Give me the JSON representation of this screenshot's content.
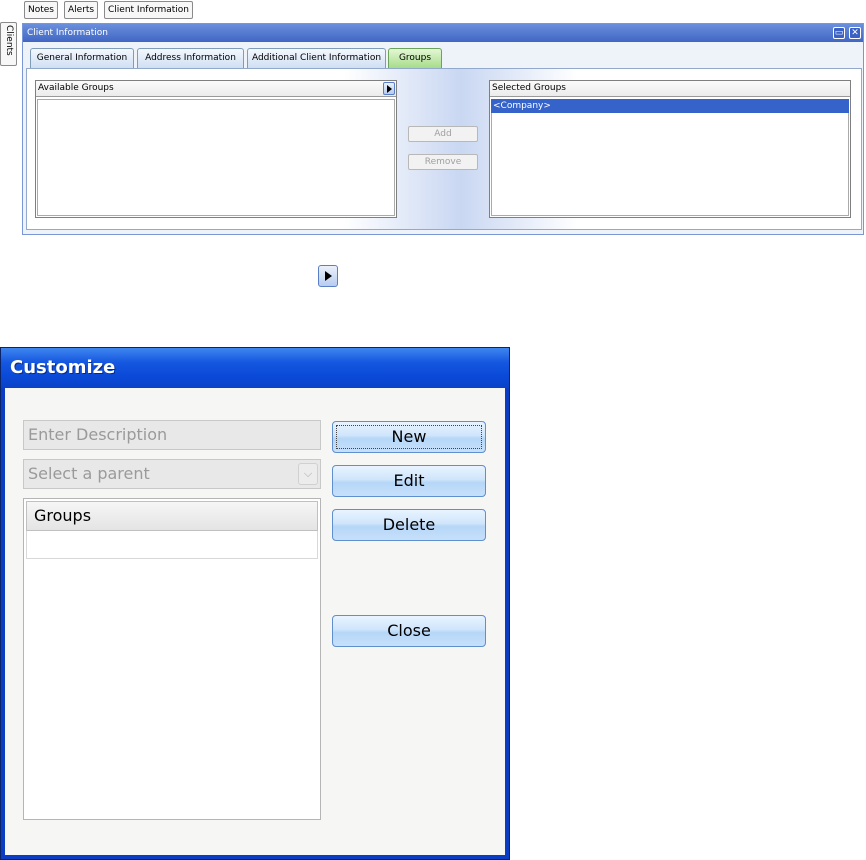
{
  "top_tabs": [
    "Notes",
    "Alerts",
    "Client Information"
  ],
  "side_tab": "Clients",
  "panel": {
    "title": "Client Information",
    "tabs": [
      "General Information",
      "Address Information",
      "Additional Client Information",
      "Groups"
    ],
    "active_tab": "Groups",
    "available_groups_label": "Available Groups",
    "selected_groups_label": "Selected Groups",
    "selected_groups_items": [
      "<Company>"
    ],
    "add_label": "Add",
    "remove_label": "Remove"
  },
  "dialog": {
    "title": "Customize",
    "description_placeholder": "Enter Description",
    "parent_placeholder": "Select a parent",
    "groups_header": "Groups",
    "new_label": "New",
    "edit_label": "Edit",
    "delete_label": "Delete",
    "close_label": "Close"
  },
  "icons": {
    "expand_arrow": "arrow-right-icon",
    "dropdown": "chevron-down-icon",
    "restore": "restore-icon",
    "close": "close-icon"
  },
  "colors": {
    "title_bar_blue": "#1658e0",
    "selection_blue": "#3563c9",
    "active_tab_green": "#a6dc8a"
  }
}
